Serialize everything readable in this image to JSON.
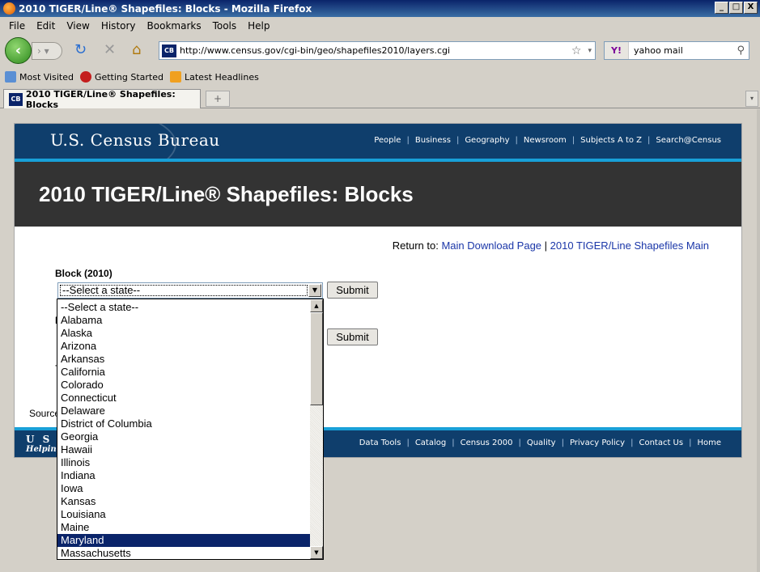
{
  "window": {
    "title": "2010 TIGER/Line® Shapefiles: Blocks - Mozilla Firefox",
    "buttons": {
      "minimize": "_",
      "maximize": "□",
      "close": "X"
    }
  },
  "menu": [
    "File",
    "Edit",
    "View",
    "History",
    "Bookmarks",
    "Tools",
    "Help"
  ],
  "navbar": {
    "url": "http://www.census.gov/cgi-bin/geo/shapefiles2010/layers.cgi",
    "site_badge": "CB",
    "search_engine": "Y!",
    "search_value": "yahoo mail"
  },
  "bookmarks": [
    "Most Visited",
    "Getting Started",
    "Latest Headlines"
  ],
  "tab": {
    "label": "2010 TIGER/Line® Shapefiles: Blocks"
  },
  "page": {
    "brand": "U.S. Census Bureau",
    "top_nav": [
      "People",
      "Business",
      "Geography",
      "Newsroom",
      "Subjects A to Z",
      "Search@Census"
    ],
    "heading": "2010 TIGER/Line® Shapefiles: Blocks",
    "return_prefix": "Return to:",
    "return_link_1": "Main Download Page",
    "return_sep": "|",
    "return_link_2": "2010 TIGER/Line Shapefiles Main",
    "block_label": "Block (2010)",
    "select_value": "--Select a state--",
    "submit_label": "Submit",
    "obscured_b": "B",
    "obscured_t": "T",
    "source_text": "Source",
    "footer_brand": "U S C",
    "footer_tag": "Helping",
    "footer_nav": [
      "Data Tools",
      "Catalog",
      "Census 2000",
      "Quality",
      "Privacy Policy",
      "Contact Us",
      "Home"
    ]
  },
  "dropdown": {
    "options": [
      "--Select a state--",
      "Alabama",
      "Alaska",
      "Arizona",
      "Arkansas",
      "California",
      "Colorado",
      "Connecticut",
      "Delaware",
      "District of Columbia",
      "Georgia",
      "Hawaii",
      "Illinois",
      "Indiana",
      "Iowa",
      "Kansas",
      "Louisiana",
      "Maine",
      "Maryland",
      "Massachusetts"
    ],
    "highlighted": "Maryland"
  }
}
